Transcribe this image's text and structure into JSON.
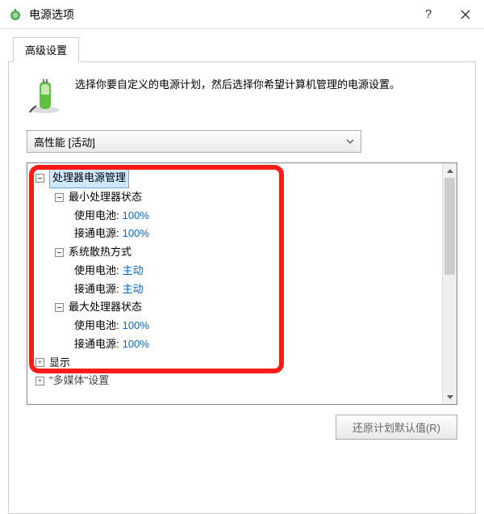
{
  "titlebar": {
    "title": "电源选项"
  },
  "tabs": {
    "advanced": "高级设置"
  },
  "description": "选择你要自定义的电源计划，然后选择你希望计算机管理的电源设置。",
  "plan": {
    "selected": "高性能 [活动]"
  },
  "tree": {
    "root_cpu": "处理器电源管理",
    "min_state": "最小处理器状态",
    "min_battery_label": "使用电池:",
    "min_battery_value": "100%",
    "min_ac_label": "接通电源:",
    "min_ac_value": "100%",
    "cooling": "系统散热方式",
    "cooling_battery_label": "使用电池:",
    "cooling_battery_value": "主动",
    "cooling_ac_label": "接通电源:",
    "cooling_ac_value": "主动",
    "max_state": "最大处理器状态",
    "max_battery_label": "使用电池:",
    "max_battery_value": "100%",
    "max_ac_label": "接通电源:",
    "max_ac_value": "100%",
    "display": "显示",
    "multimedia": "\"多媒体\"设置"
  },
  "buttons": {
    "restore": "还原计划默认值(R)"
  }
}
